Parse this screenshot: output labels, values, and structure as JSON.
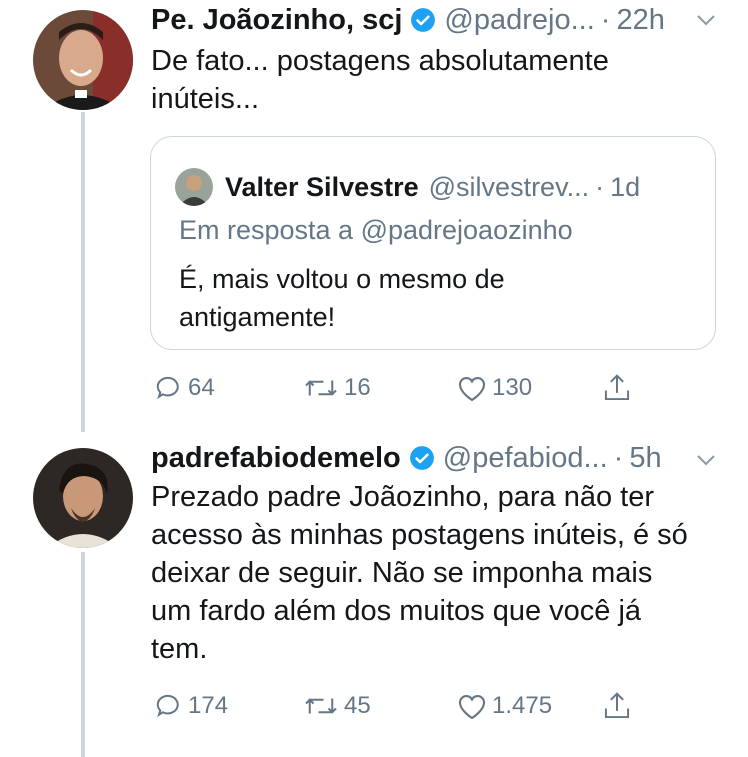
{
  "tweets": [
    {
      "name": "Pe. Joãozinho, scj",
      "handle": "@padrejo...",
      "separator": "·",
      "time": "22h",
      "text_lines": [
        "De fato... postagens absolutamente",
        "inúteis..."
      ],
      "quoted": {
        "name": "Valter Silvestre",
        "handle": "@silvestrev...",
        "separator": "·",
        "time": "1d",
        "reply_to": "Em resposta a @padrejoaozinho",
        "text_lines": [
          "É, mais voltou o mesmo de",
          "antigamente!"
        ]
      },
      "actions": {
        "replies": "64",
        "retweets": "16",
        "likes": "130"
      }
    },
    {
      "name": "padrefabiodemelo",
      "handle": "@pefabiod...",
      "separator": "·",
      "time": "5h",
      "text_lines": [
        "Prezado padre Joãozinho, para não ter",
        "acesso às minhas postagens inúteis, é só",
        "deixar de seguir. Não se imponha mais",
        "um fardo além dos muitos que você já",
        "tem."
      ],
      "actions": {
        "replies": "174",
        "retweets": "45",
        "likes": "1.475"
      }
    }
  ],
  "colors": {
    "verified": "#1da1f2",
    "muted": "#657786",
    "border": "#ccd6dd"
  },
  "icons": [
    "reply-icon",
    "retweet-icon",
    "like-icon",
    "share-icon",
    "verified-icon",
    "chevron-down-icon"
  ]
}
